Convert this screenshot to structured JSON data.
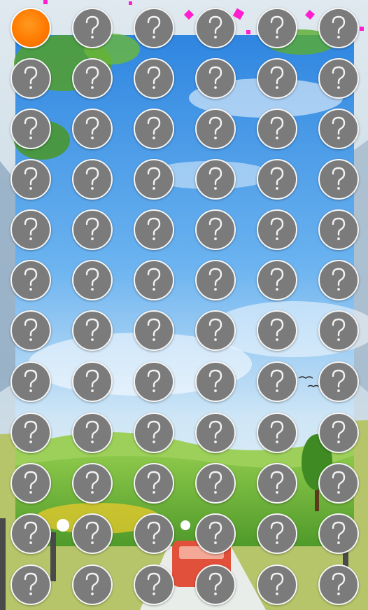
{
  "game": {
    "board": {
      "rows": 12,
      "cols": 6,
      "hidden_symbol": "question-mark-icon",
      "revealed_tiles": [
        {
          "row": 0,
          "col": 0,
          "color": "#ff7a00"
        }
      ]
    },
    "colors": {
      "tile_hidden": "#7b7b7b",
      "tile_border": "#f6f6f6",
      "tile_revealed": "#ff7a00",
      "confetti": "#ff1fd0"
    },
    "background": "sky-meadow-road-van-scene"
  }
}
